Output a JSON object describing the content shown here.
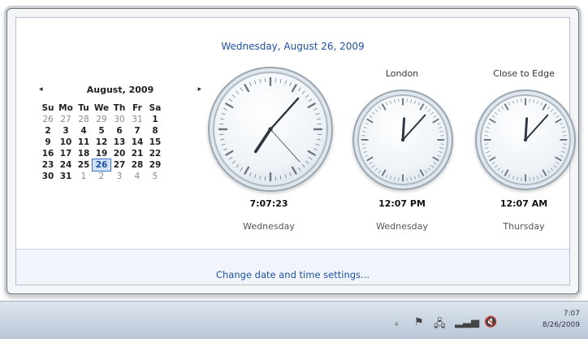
{
  "header_date": "Wednesday, August 26, 2009",
  "calendar": {
    "month_label": "August, 2009",
    "prev_icon": "◂",
    "next_icon": "▸",
    "weekdays": [
      "Su",
      "Mo",
      "Tu",
      "We",
      "Th",
      "Fr",
      "Sa"
    ],
    "weeks": [
      [
        "26",
        "27",
        "28",
        "29",
        "30",
        "31",
        "1"
      ],
      [
        "2",
        "3",
        "4",
        "5",
        "6",
        "7",
        "8"
      ],
      [
        "9",
        "10",
        "11",
        "12",
        "13",
        "14",
        "15"
      ],
      [
        "16",
        "17",
        "18",
        "19",
        "20",
        "21",
        "22"
      ],
      [
        "23",
        "24",
        "25",
        "26",
        "27",
        "28",
        "29"
      ],
      [
        "30",
        "31",
        "1",
        "2",
        "3",
        "4",
        "5"
      ]
    ],
    "selected_day": "26"
  },
  "clocks": [
    {
      "title": "",
      "time": "7:07:23",
      "day": "Wednesday",
      "hour": 7,
      "minute": 7,
      "second": 23
    },
    {
      "title": "London",
      "time": "12:07 PM",
      "day": "Wednesday",
      "hour": 12,
      "minute": 7
    },
    {
      "title": "Close to Edge",
      "time": "12:07 AM",
      "day": "Thursday",
      "hour": 12,
      "minute": 7
    }
  ],
  "footer_link": "Change date and time settings...",
  "taskbar": {
    "tray_icons": [
      "show-hidden-icons-icon",
      "action-center-flag-icon",
      "network-icon",
      "signal-icon",
      "volume-muted-icon"
    ],
    "time": "7:07",
    "date": "8/26/2009"
  },
  "colors": {
    "link": "#1e50a0",
    "selected_day_bg": "#cfe2fa"
  }
}
